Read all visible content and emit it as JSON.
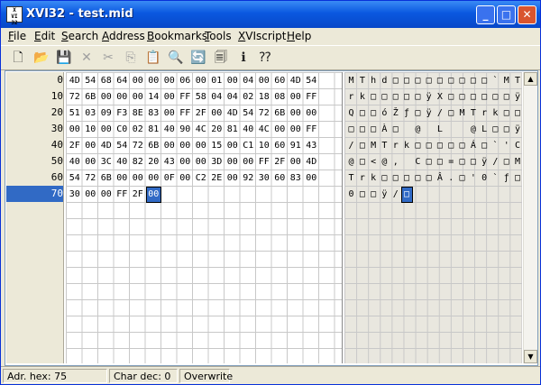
{
  "window": {
    "title": "XVI32 - test.mid",
    "icon": "XVI-app-icon"
  },
  "titlebar_buttons": {
    "minimize": "_",
    "maximize": "□",
    "close": "✕"
  },
  "menu": [
    {
      "label": "File",
      "accel": "F",
      "rest": "ile"
    },
    {
      "label": "Edit",
      "accel": "E",
      "rest": "dit"
    },
    {
      "label": "Search",
      "accel": "S",
      "rest": "earch"
    },
    {
      "label": "Address",
      "accel": "A",
      "rest": "ddress"
    },
    {
      "label": "Bookmarks",
      "accel": "B",
      "rest": "ookmarks"
    },
    {
      "label": "Tools",
      "accel": "T",
      "rest": "ools"
    },
    {
      "label": "XVIscript",
      "accel": "X",
      "rest": "VIscript"
    },
    {
      "label": "Help",
      "accel": "H",
      "rest": "elp"
    }
  ],
  "toolbar": [
    {
      "icon": "new-file-icon",
      "glyph": "🗋",
      "enabled": true
    },
    {
      "icon": "open-folder-icon",
      "glyph": "📂",
      "enabled": true
    },
    {
      "icon": "save-icon",
      "glyph": "💾",
      "enabled": true
    },
    {
      "icon": "delete-icon",
      "glyph": "✕",
      "enabled": false
    },
    {
      "icon": "cut-icon",
      "glyph": "✂",
      "enabled": false
    },
    {
      "icon": "copy-icon",
      "glyph": "⎘",
      "enabled": false
    },
    {
      "icon": "paste-icon",
      "glyph": "📋",
      "enabled": false
    },
    {
      "icon": "find-icon",
      "glyph": "🔍",
      "enabled": true
    },
    {
      "icon": "replace-icon",
      "glyph": "🔄",
      "enabled": true
    },
    {
      "icon": "bookmark-icon",
      "glyph": "🗐",
      "enabled": true
    },
    {
      "icon": "info-icon",
      "glyph": "ℹ",
      "enabled": true
    },
    {
      "icon": "context-help-icon",
      "glyph": "⁇",
      "enabled": true
    }
  ],
  "addresses": [
    "0",
    "10",
    "20",
    "30",
    "40",
    "50",
    "60",
    "70"
  ],
  "selected_address": "70",
  "hex_rows": [
    [
      "4D",
      "54",
      "68",
      "64",
      "00",
      "00",
      "00",
      "06",
      "00",
      "01",
      "00",
      "04",
      "00",
      "60",
      "4D",
      "54"
    ],
    [
      "72",
      "6B",
      "00",
      "00",
      "00",
      "14",
      "00",
      "FF",
      "58",
      "04",
      "04",
      "02",
      "18",
      "08",
      "00",
      "FF"
    ],
    [
      "51",
      "03",
      "09",
      "F3",
      "8E",
      "83",
      "00",
      "FF",
      "2F",
      "00",
      "4D",
      "54",
      "72",
      "6B",
      "00",
      "00"
    ],
    [
      "00",
      "10",
      "00",
      "C0",
      "02",
      "81",
      "40",
      "90",
      "4C",
      "20",
      "81",
      "40",
      "4C",
      "00",
      "00",
      "FF"
    ],
    [
      "2F",
      "00",
      "4D",
      "54",
      "72",
      "6B",
      "00",
      "00",
      "00",
      "15",
      "00",
      "C1",
      "10",
      "60",
      "91",
      "43"
    ],
    [
      "40",
      "00",
      "3C",
      "40",
      "82",
      "20",
      "43",
      "00",
      "00",
      "3D",
      "00",
      "00",
      "FF",
      "2F",
      "00",
      "4D"
    ],
    [
      "54",
      "72",
      "6B",
      "00",
      "00",
      "00",
      "0F",
      "00",
      "C2",
      "2E",
      "00",
      "92",
      "30",
      "60",
      "83",
      "00"
    ],
    [
      "30",
      "00",
      "00",
      "FF",
      "2F",
      "00"
    ]
  ],
  "char_rows": [
    [
      "M",
      "T",
      "h",
      "d",
      "□",
      "□",
      "□",
      "□",
      "□",
      "□",
      "□",
      "□",
      "□",
      "`",
      "M",
      "T"
    ],
    [
      "r",
      "k",
      "□",
      "□",
      "□",
      "□",
      "□",
      "ÿ",
      "X",
      "□",
      "□",
      "□",
      "□",
      "□",
      "□",
      "ÿ"
    ],
    [
      "Q",
      "□",
      "□",
      "ó",
      "Ž",
      "ƒ",
      "□",
      "ÿ",
      "/",
      "□",
      "M",
      "T",
      "r",
      "k",
      "□",
      "□"
    ],
    [
      "□",
      "□",
      "□",
      "À",
      "□",
      "",
      "@",
      "",
      "L",
      "",
      "",
      "@",
      "L",
      "□",
      "□",
      "ÿ"
    ],
    [
      "/",
      "□",
      "M",
      "T",
      "r",
      "k",
      "□",
      "□",
      "□",
      "□",
      "□",
      "Á",
      "□",
      "`",
      "'",
      "C"
    ],
    [
      "@",
      "□",
      "<",
      "@",
      "‚",
      "",
      "C",
      "□",
      "□",
      "=",
      "□",
      "□",
      "ÿ",
      "/",
      "□",
      "M"
    ],
    [
      "T",
      "r",
      "k",
      "□",
      "□",
      "□",
      "□",
      "□",
      "Â",
      ".",
      "□",
      "'",
      "0",
      "`",
      "ƒ",
      "□"
    ],
    [
      "0",
      "□",
      "□",
      "ÿ",
      "/",
      "□"
    ]
  ],
  "selected_cell": {
    "row": 7,
    "col": 5
  },
  "status": {
    "adr_hex": "Adr. hex: 75",
    "char_dec": "Char dec: 0",
    "mode": "Overwrite"
  }
}
